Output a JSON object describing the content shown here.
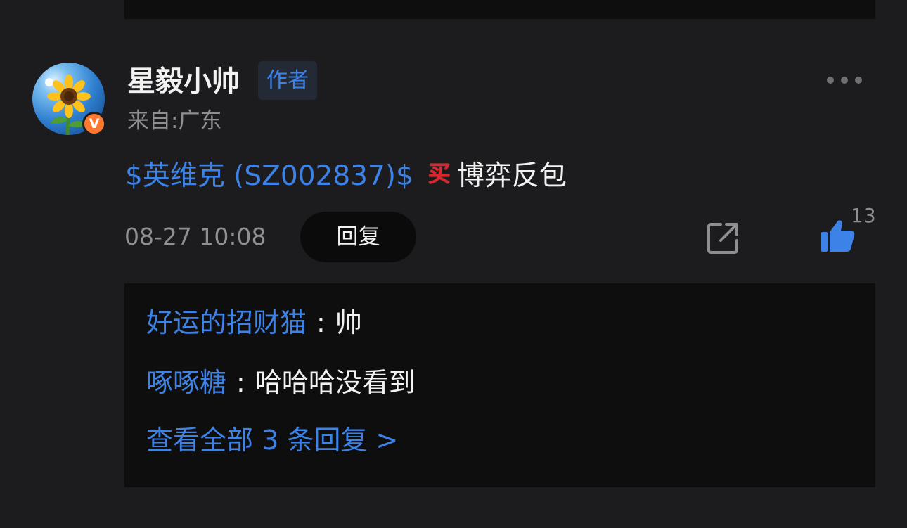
{
  "comment": {
    "username": "星毅小帅",
    "author_badge": "作者",
    "location": "来自:广东",
    "verified_badge": "V",
    "stock_link": "$英维克 (SZ002837)$",
    "buy_tag": "买",
    "content_text": "博弈反包",
    "timestamp": "08-27 10:08",
    "reply_label": "回复",
    "like_count": "13"
  },
  "replies": [
    {
      "user": "好运的招财猫",
      "sep": ":",
      "text": "帅"
    },
    {
      "user": "啄啄糖",
      "sep": ":",
      "text": "哈哈哈没看到"
    }
  ],
  "view_all_label": "查看全部 3 条回复 >",
  "icons": {
    "more": "more-dots-icon",
    "share": "share-icon",
    "like": "thumbs-up-icon",
    "avatar": "sunflower-avatar"
  },
  "colors": {
    "background": "#1c1c1e",
    "panel": "#0e0e0f",
    "accent_blue": "#3d82e6",
    "muted": "#8e8e93",
    "verified_orange": "#ff7a30",
    "buy_red": "#e0242c"
  }
}
